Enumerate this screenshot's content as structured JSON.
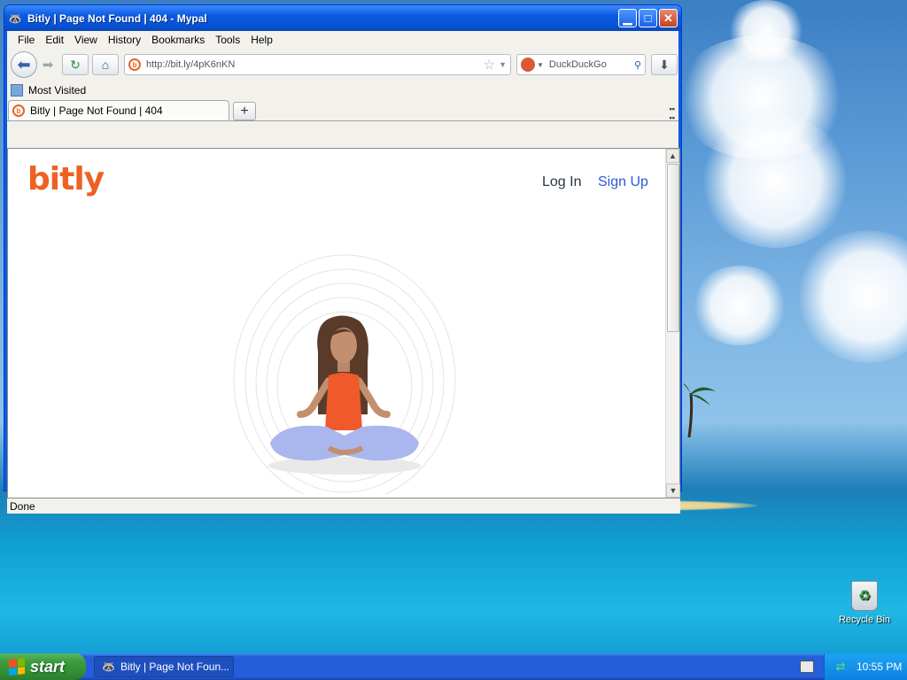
{
  "window": {
    "title": "Bitly  | Page Not Found | 404 - Mypal",
    "minimize_icon": "minimize-icon",
    "maximize_icon": "maximize-icon",
    "close_icon": "close-icon"
  },
  "menu": [
    "File",
    "Edit",
    "View",
    "History",
    "Bookmarks",
    "Tools",
    "Help"
  ],
  "nav": {
    "url": "http://bit.ly/4pK6nKN",
    "search_engine": "DuckDuckGo",
    "back_icon": "arrow-left-icon",
    "forward_icon": "arrow-right-icon",
    "reload_icon": "reload-icon",
    "home_icon": "home-icon",
    "download_icon": "download-icon"
  },
  "bookmarks": {
    "most_visited": "Most Visited"
  },
  "tabs": [
    {
      "label": "Bitly | Page Not Found | 404"
    }
  ],
  "page": {
    "logo": "bitly",
    "login": "Log In",
    "signup": "Sign Up",
    "brand_color": "#ee6123",
    "link_color": "#2a5bd7"
  },
  "status": {
    "text": "Done"
  },
  "desktop": {
    "recycle_bin": "Recycle Bin"
  },
  "taskbar": {
    "start": "start",
    "items": [
      {
        "label": "Bitly | Page Not Foun..."
      }
    ],
    "clock": "10:55 PM"
  }
}
